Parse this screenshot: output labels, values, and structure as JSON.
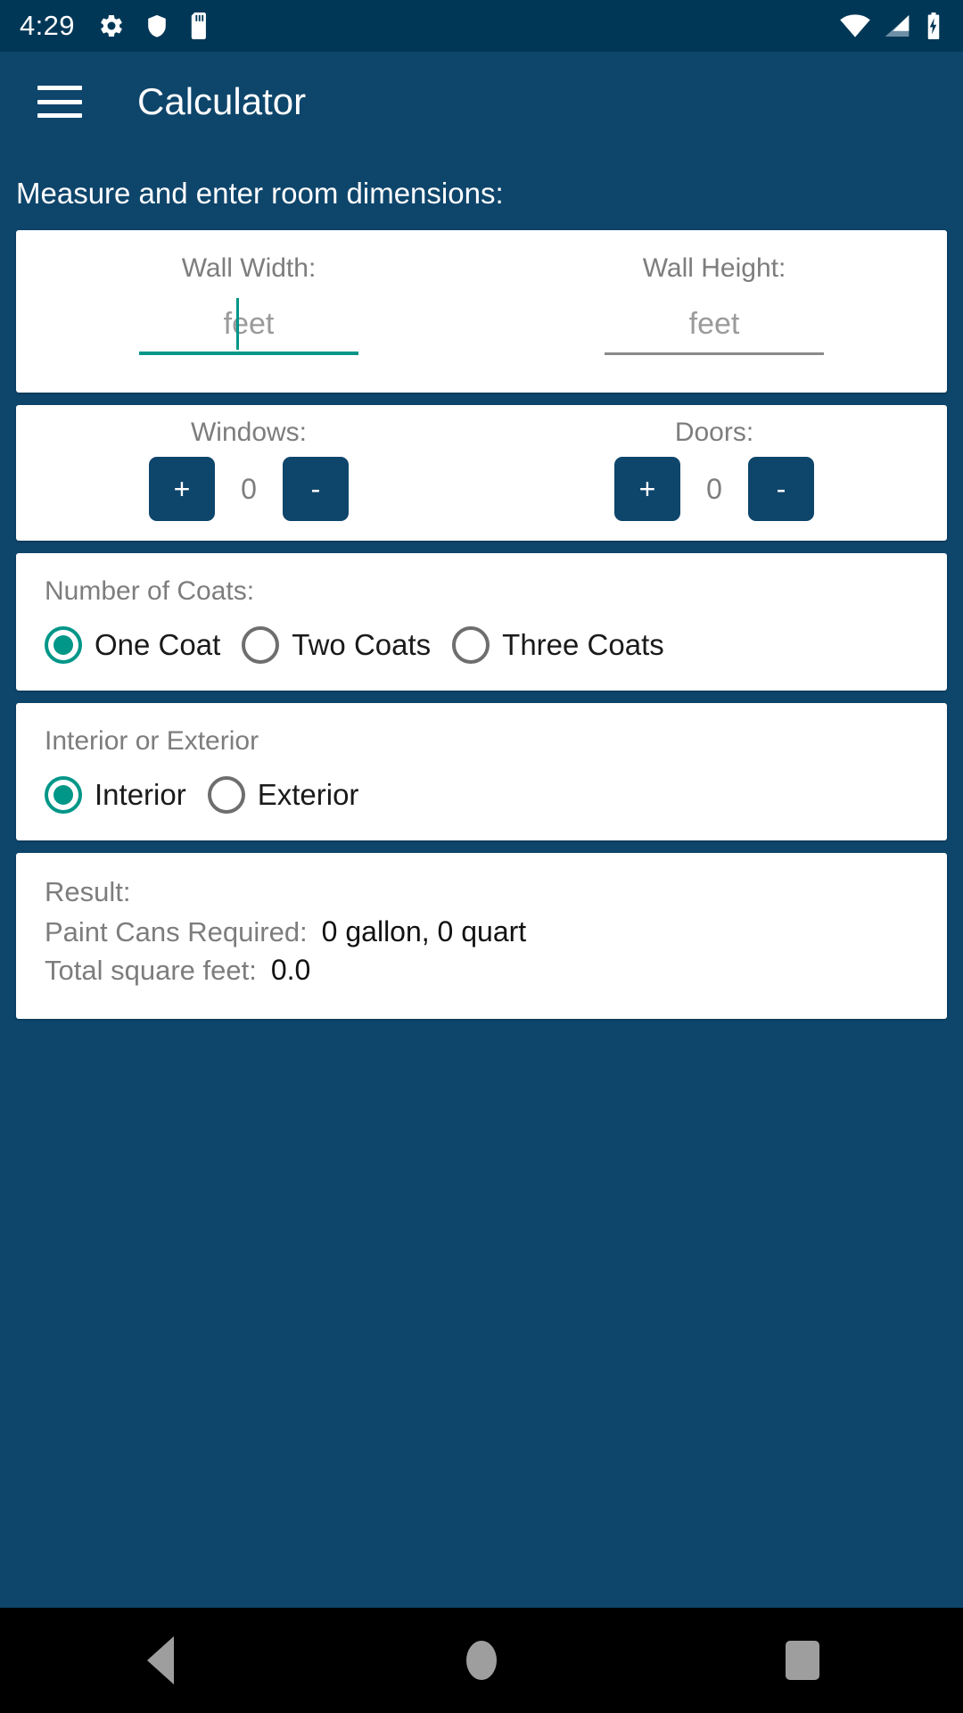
{
  "status_bar": {
    "time": "4:29",
    "left_icons": [
      "gear-icon",
      "shield-icon",
      "sd-card-icon"
    ],
    "right_icons": [
      "wifi-icon",
      "cellular-signal-icon",
      "battery-charging-icon"
    ],
    "background_color": "#013756"
  },
  "app_bar": {
    "menu_icon": "hamburger-menu-icon",
    "title": "Calculator",
    "background_color": "#0E456B"
  },
  "theme": {
    "background": "#0E456B",
    "accent": "#009688",
    "card": "#FFFFFF",
    "label_gray": "#7D7D7D"
  },
  "main": {
    "heading": "Measure and enter room dimensions:",
    "dimensions": {
      "wall_width": {
        "label": "Wall Width:",
        "value": "",
        "placeholder": "feet",
        "focused": true
      },
      "wall_height": {
        "label": "Wall Height:",
        "value": "",
        "placeholder": "feet",
        "focused": false
      }
    },
    "counters": [
      {
        "label": "Windows:",
        "increment_label": "+",
        "decrement_label": "-",
        "value": "0"
      },
      {
        "label": "Doors:",
        "increment_label": "+",
        "decrement_label": "-",
        "value": "0"
      }
    ],
    "coats": {
      "label": "Number of Coats:",
      "options": [
        {
          "label": "One Coat",
          "selected": true
        },
        {
          "label": "Two Coats",
          "selected": false
        },
        {
          "label": "Three Coats",
          "selected": false
        }
      ]
    },
    "surface": {
      "label": "Interior or Exterior",
      "options": [
        {
          "label": "Interior",
          "selected": true
        },
        {
          "label": "Exterior",
          "selected": false
        }
      ]
    },
    "result": {
      "title": "Result:",
      "paint_cans_label": "Paint Cans Required:",
      "paint_cans_value": "0 gallon, 0 quart",
      "total_sqft_label": "Total square feet:",
      "total_sqft_value": "0.0"
    }
  },
  "nav_bar": {
    "back_icon": "back-triangle-icon",
    "home_icon": "home-circle-icon",
    "recents_icon": "recents-square-icon"
  }
}
